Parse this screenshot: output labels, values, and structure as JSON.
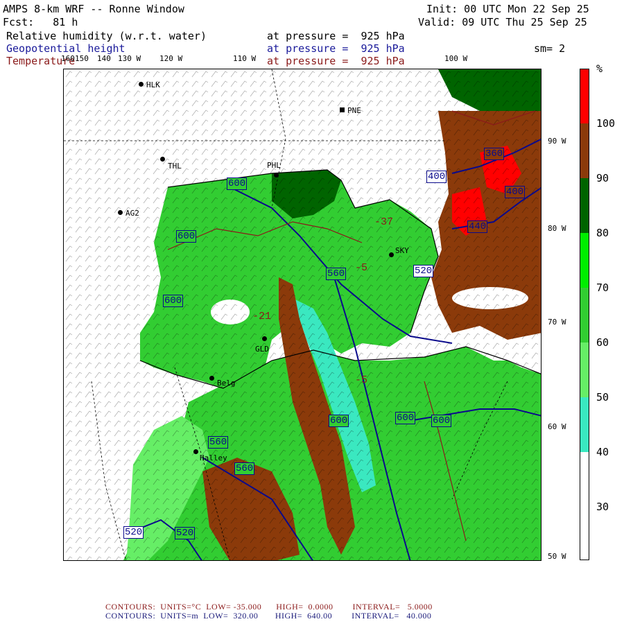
{
  "header": {
    "title": "AMPS 8-km WRF -- Ronne Window",
    "forecast": "Fcst:   81 h",
    "init": "Init: 00 UTC Mon 22 Sep 25",
    "valid": "Valid: 09 UTC Thu 25 Sep 25",
    "smoothing": "sm= 2",
    "fields": [
      {
        "name": "Relative humidity (w.r.t. water)",
        "level": "at pressure =  925 hPa",
        "color": "#000000"
      },
      {
        "name": "Geopotential height",
        "level": "at pressure =  925 hPa",
        "color": "#1a1a9a"
      },
      {
        "name": "Temperature",
        "level": "at pressure =  925 hPa",
        "color": "#8b1a1a"
      }
    ]
  },
  "map": {
    "lon_labels": [
      "160",
      "150",
      "140",
      "130 W",
      "120 W",
      "110 W",
      "100 W"
    ],
    "lat_labels": [
      "90 W",
      "80 W",
      "70 W",
      "60 W",
      "50 W"
    ],
    "stations": [
      {
        "name": "HLK"
      },
      {
        "name": "PNE"
      },
      {
        "name": "THL"
      },
      {
        "name": "PHL"
      },
      {
        "name": "AG2"
      },
      {
        "name": "SKY"
      },
      {
        "name": "GLD"
      },
      {
        "name": "Belg"
      },
      {
        "name": "Halley"
      }
    ],
    "height_contour_labels": [
      "600",
      "600",
      "600",
      "400",
      "360",
      "400",
      "440",
      "520",
      "560",
      "600",
      "600",
      "600",
      "560",
      "560",
      "520",
      "520"
    ],
    "temp_contour_labels": [
      "-37",
      "-5",
      "-21",
      "-5"
    ],
    "colors": {
      "height_contours": "#0a0a8c",
      "temp_contours": "#8b1a1a"
    }
  },
  "colorbar": {
    "unit": "%",
    "labels": [
      "100",
      "90",
      "80",
      "70",
      "60",
      "50",
      "40",
      "30"
    ],
    "colors": [
      "#ff0000",
      "#8b3a0a",
      "#006400",
      "#00ee00",
      "#32cd32",
      "#66ee66",
      "#3ae8c0",
      "#ffffff"
    ]
  },
  "footer": {
    "temp_line": "CONTOURS:  UNITS=°C  LOW= -35.000      HIGH=  0.0000        INTERVAL=   5.0000",
    "height_line": "CONTOURS:  UNITS=m  LOW=  320.00       HIGH=  640.00        INTERVAL=   40.000"
  }
}
